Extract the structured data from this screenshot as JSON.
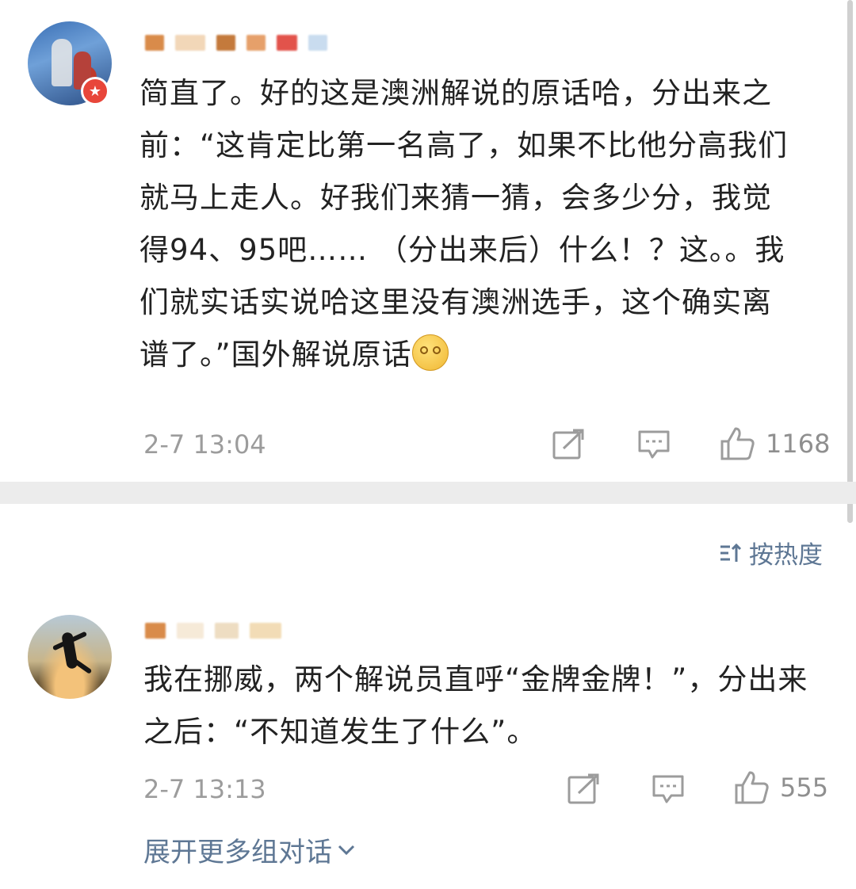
{
  "comments": [
    {
      "text_lines": [
        "简直了。好的这是澳洲解说的原话哈，分出来之",
        "前：“这肯定比第一名高了，如果不比他分高我们",
        "就马上走人。好我们来猜一猜，会多少分，我觉",
        "得94、95吧…… （分出来后）什么！？这。。我",
        "们就实话实说哈这里没有澳洲选手，这个确实离",
        "谱了。”国外解说原话"
      ],
      "time": "2-7 13:04",
      "likes": "1168",
      "avatar_icon": "tennis-player-avatar",
      "badge_icon": "verified-star-icon"
    },
    {
      "text_lines": [
        "我在挪威，两个解说员直呼“金牌金牌！”，分出来",
        "之后：“不知道发生了什么”。"
      ],
      "time": "2-7 13:13",
      "likes": "555",
      "avatar_icon": "jumping-silhouette-avatar"
    }
  ],
  "sort_label": "按热度",
  "expand_label": "展开更多组对话",
  "colors": {
    "link_blue": "#5e7794",
    "meta_gray": "#9c9c9c",
    "badge_red": "#e8463a",
    "divider": "#ececec"
  }
}
